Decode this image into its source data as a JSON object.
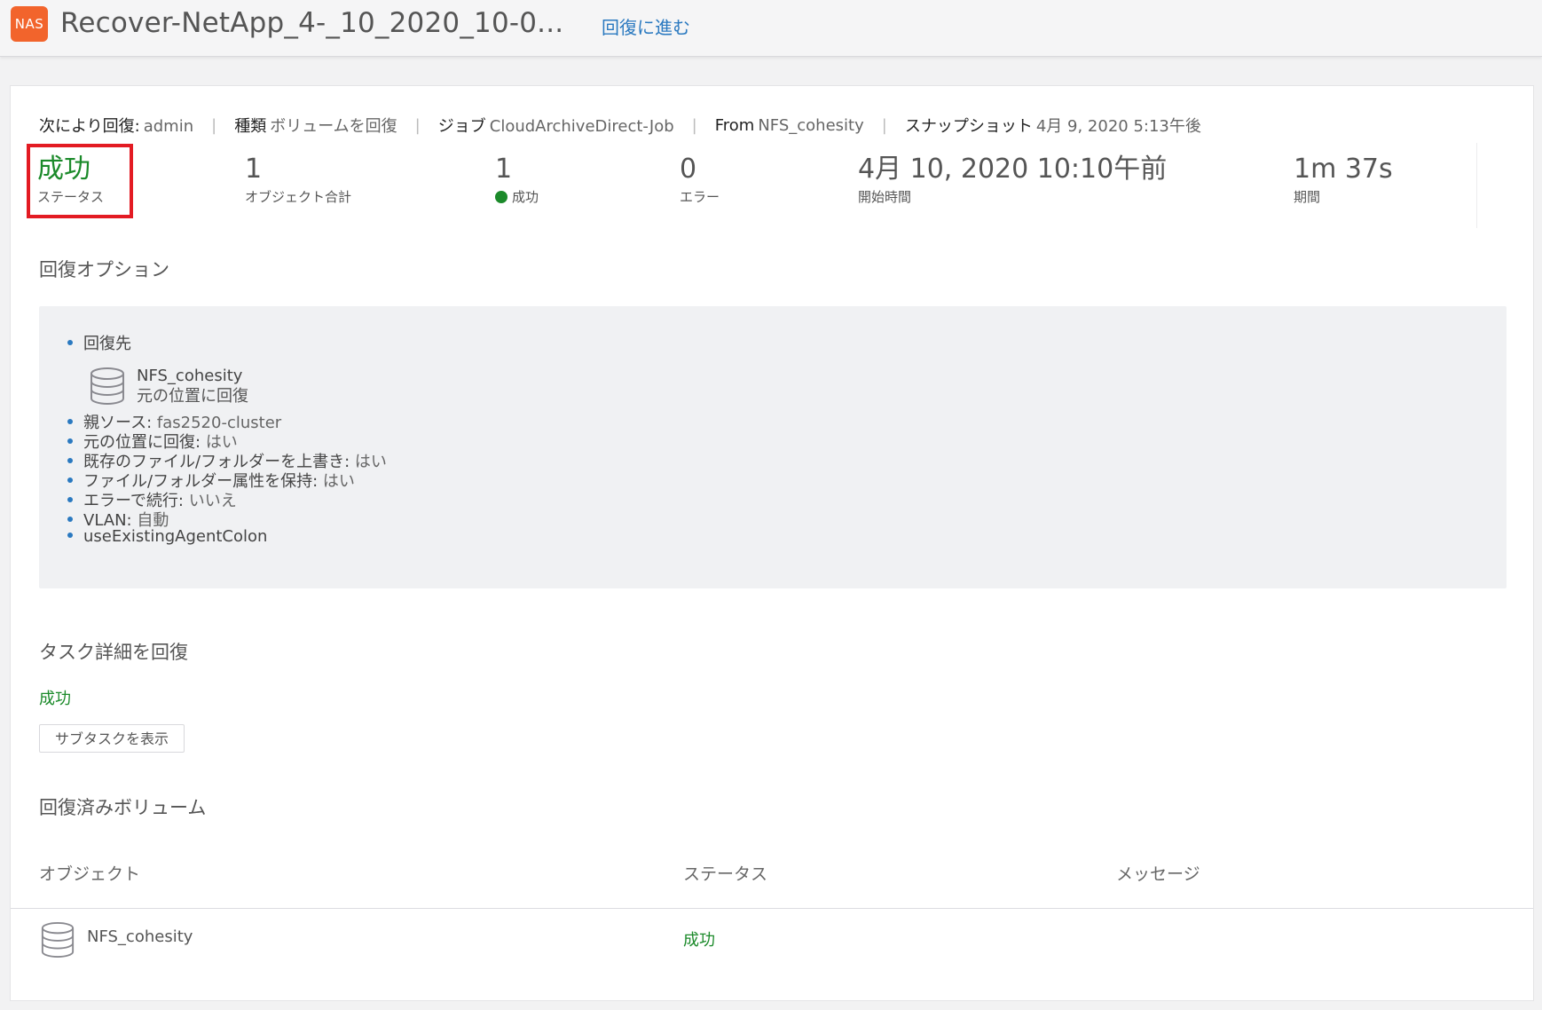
{
  "header": {
    "badge": "NAS",
    "title": "Recover-NetApp_4-_10_2020_10-0...",
    "link": "回復に進む"
  },
  "meta": {
    "recovered_by_label": "次により回復:",
    "recovered_by_value": "admin",
    "type_label": "種類",
    "type_value": "ボリュームを回復",
    "job_label": "ジョブ",
    "job_value": "CloudArchiveDirect-Job",
    "from_label": "From",
    "from_value": "NFS_cohesity",
    "snapshot_label": "スナップショット",
    "snapshot_value": "4月 9, 2020 5:13午後"
  },
  "stats": {
    "status_value": "成功",
    "status_label": "ステータス",
    "objects_value": "1",
    "objects_label": "オブジェクト合計",
    "success_value": "1",
    "success_label": "成功",
    "error_value": "0",
    "error_label": "エラー",
    "start_value": "4月 10, 2020 10:10午前",
    "start_label": "開始時間",
    "duration_value": "1m 37s",
    "duration_label": "期間",
    "success_dot_color": "#1b8a2a"
  },
  "options": {
    "title": "回復オプション",
    "destination_label": "回復先",
    "destination_icon": "database-icon",
    "destination_name": "NFS_cohesity",
    "destination_sub": "元の位置に回復",
    "items": [
      {
        "label": "親ソース:",
        "value": "fas2520-cluster"
      },
      {
        "label": "元の位置に回復:",
        "value": "はい"
      },
      {
        "label": "既存のファイル/フォルダーを上書き:",
        "value": "はい"
      },
      {
        "label": "ファイル/フォルダー属性を保持:",
        "value": "はい"
      },
      {
        "label": "エラーで続行:",
        "value": "いいえ"
      },
      {
        "label": "VLAN:",
        "value": "自動"
      },
      {
        "label": "useExistingAgentColon",
        "value": ""
      }
    ]
  },
  "task": {
    "title": "タスク詳細を回復",
    "status": "成功",
    "subtask_button": "サブタスクを表示"
  },
  "volumes": {
    "title": "回復済みボリューム",
    "columns": [
      "オブジェクト",
      "ステータス",
      "メッセージ"
    ],
    "rows": [
      {
        "object": "NFS_cohesity",
        "status": "成功",
        "message": "",
        "icon": "database-icon"
      }
    ]
  }
}
